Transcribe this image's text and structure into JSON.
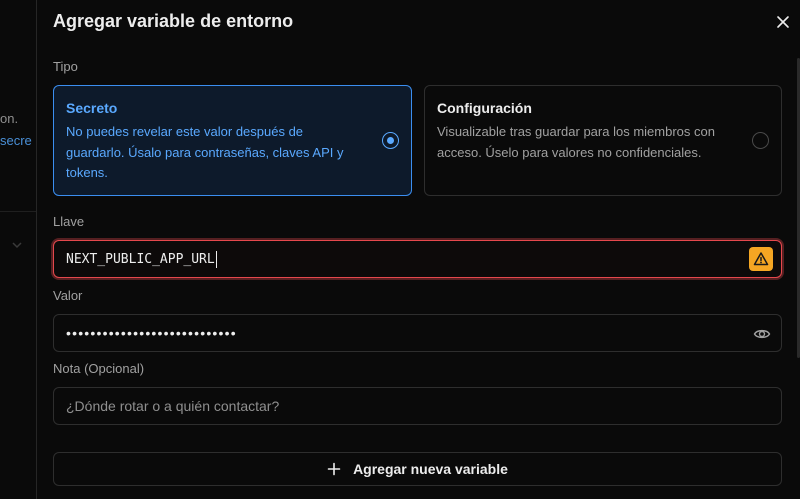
{
  "background": {
    "text_fragment_1": "on.",
    "text_fragment_2": "secre"
  },
  "modal": {
    "title": "Agregar variable de entorno",
    "type_label": "Tipo",
    "options": [
      {
        "title": "Secreto",
        "description": "No puedes revelar este valor después de guardarlo. Úsalo para contraseñas, claves API y tokens.",
        "selected": true
      },
      {
        "title": "Configuración",
        "description": "Visualizable tras guardar para los miembros con acceso. Úselo para valores no confidenciales.",
        "selected": false
      }
    ],
    "key_label": "Llave",
    "key_value": "NEXT_PUBLIC_APP_URL",
    "value_label": "Valor",
    "value_masked": "••••••••••••••••••••••••••••",
    "note_label": "Nota (Opcional)",
    "note_placeholder": "¿Dónde rotar o a quién contactar?",
    "add_button_label": "Agregar nueva variable"
  },
  "colors": {
    "accent": "#5aa9ff",
    "error": "#e5484d",
    "warning": "#f5a623"
  },
  "icons": [
    "close-icon",
    "warning-icon",
    "eye-icon",
    "plus-icon",
    "chevron-down-icon"
  ]
}
